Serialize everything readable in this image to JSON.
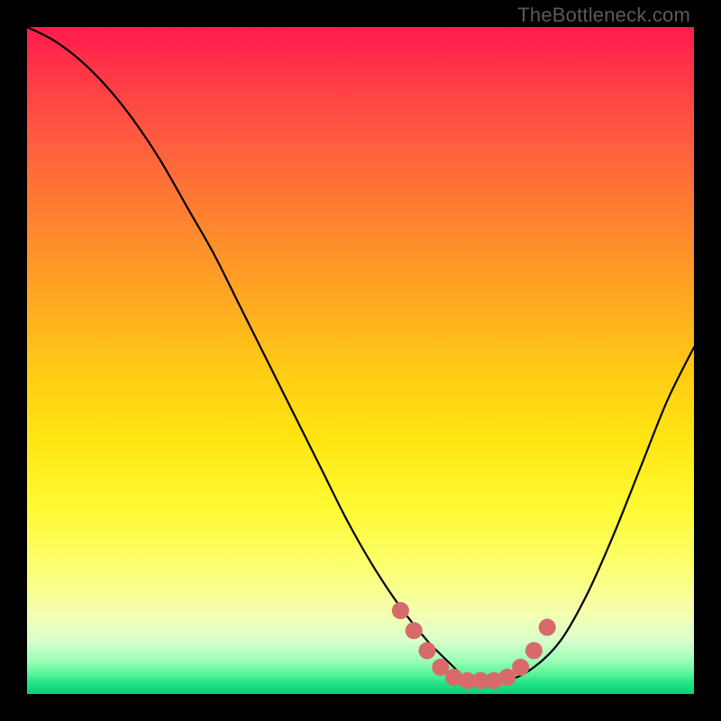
{
  "watermark": "TheBottleneck.com",
  "colors": {
    "curve_stroke": "#000000",
    "marker_fill": "#d86a69",
    "marker_stroke": "#d86a69",
    "background": "#000000"
  },
  "chart_data": {
    "type": "line",
    "title": "",
    "xlabel": "",
    "ylabel": "",
    "xlim": [
      0,
      100
    ],
    "ylim": [
      0,
      100
    ],
    "series": [
      {
        "name": "bottleneck-curve",
        "x": [
          0,
          4,
          8,
          12,
          16,
          20,
          24,
          28,
          32,
          36,
          40,
          44,
          48,
          52,
          56,
          60,
          64,
          66,
          68,
          72,
          76,
          80,
          84,
          88,
          92,
          96,
          100
        ],
        "y": [
          100,
          98,
          95,
          91,
          86,
          80,
          73,
          66,
          58,
          50,
          42,
          34,
          26,
          19,
          13,
          8,
          4,
          2,
          2,
          2,
          4,
          8,
          15,
          24,
          34,
          44,
          52
        ]
      }
    ],
    "markers": [
      {
        "x": 56.0,
        "y": 12.5
      },
      {
        "x": 58.0,
        "y": 9.5
      },
      {
        "x": 60.0,
        "y": 6.5
      },
      {
        "x": 62.0,
        "y": 4.0
      },
      {
        "x": 64.0,
        "y": 2.5
      },
      {
        "x": 66.0,
        "y": 2.0
      },
      {
        "x": 68.0,
        "y": 2.0
      },
      {
        "x": 70.0,
        "y": 2.0
      },
      {
        "x": 72.0,
        "y": 2.5
      },
      {
        "x": 74.0,
        "y": 4.0
      },
      {
        "x": 76.0,
        "y": 6.5
      },
      {
        "x": 78.0,
        "y": 10.0
      }
    ]
  }
}
